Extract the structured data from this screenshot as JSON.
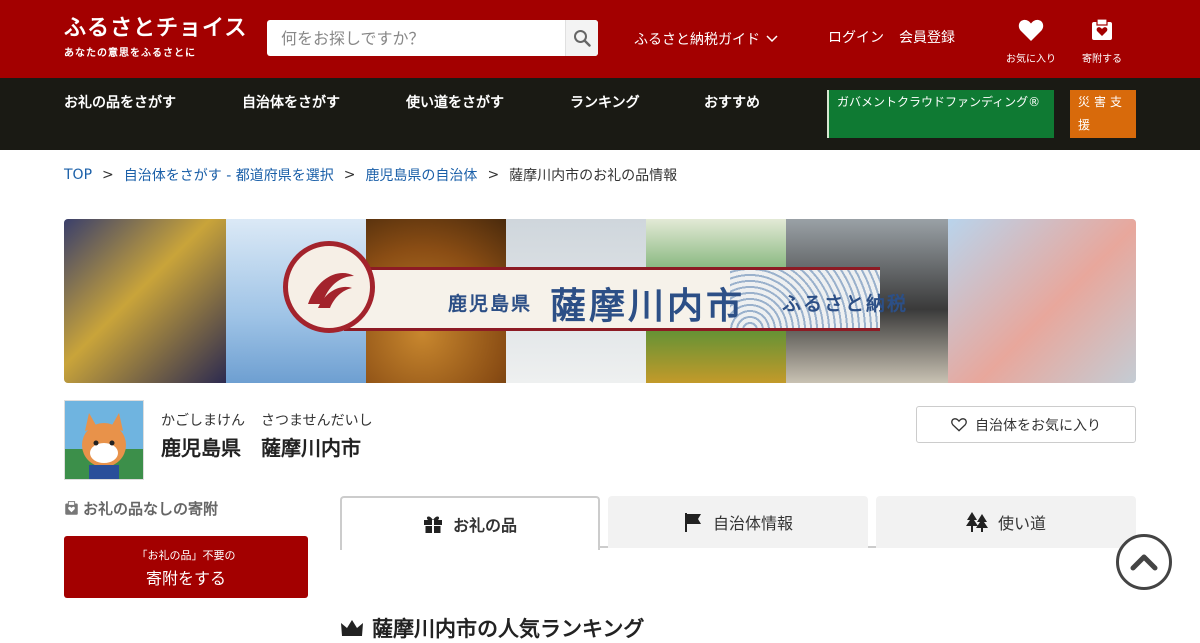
{
  "header": {
    "logo_main": "ふるさとチョイス",
    "logo_sub": "あなたの意思をふるさとに",
    "search_placeholder": "何をお探しですか？",
    "guide_label": "ふるさと納税ガイド",
    "login_label": "ログイン",
    "register_label": "会員登録",
    "favorites_label": "お気に入り",
    "donate_label": "寄附する"
  },
  "nav": {
    "items": [
      "お礼の品をさがす",
      "自治体をさがす",
      "使い道をさがす",
      "ランキング",
      "おすすめ"
    ],
    "gcf_label": "ガバメントクラウドファンディング®",
    "disaster_label": "災害支援"
  },
  "breadcrumb": {
    "items": [
      "TOP",
      "自治体をさがす - 都道府県を選択",
      "鹿児島県の自治体"
    ],
    "current": "薩摩川内市のお礼の品情報",
    "separator": ">"
  },
  "banner": {
    "prefecture": "鹿児島県",
    "city": "薩摩川内市",
    "tagline": "ふるさと納税"
  },
  "municipality": {
    "pref_kana": "かごしまけん",
    "city_kana": "さつませんだいし",
    "pref_name": "鹿児島県",
    "city_name": "薩摩川内市",
    "favorite_button": "自治体をお気に入り"
  },
  "sidebar": {
    "nogift_title": "お礼の品なしの寄附",
    "donate_small": "「お礼の品」不要の",
    "donate_big": "寄附をする"
  },
  "tabs": [
    {
      "label": "お礼の品",
      "active": true
    },
    {
      "label": "自治体情報",
      "active": false
    },
    {
      "label": "使い道",
      "active": false
    }
  ],
  "ranking_title": "薩摩川内市の人気ランキング",
  "colors": {
    "brand_red": "#a30000",
    "nav_bg": "#1a1a14",
    "gcf_green": "#0f7a33",
    "disaster_orange": "#d86a0b",
    "link_blue": "#1a5fa8"
  }
}
